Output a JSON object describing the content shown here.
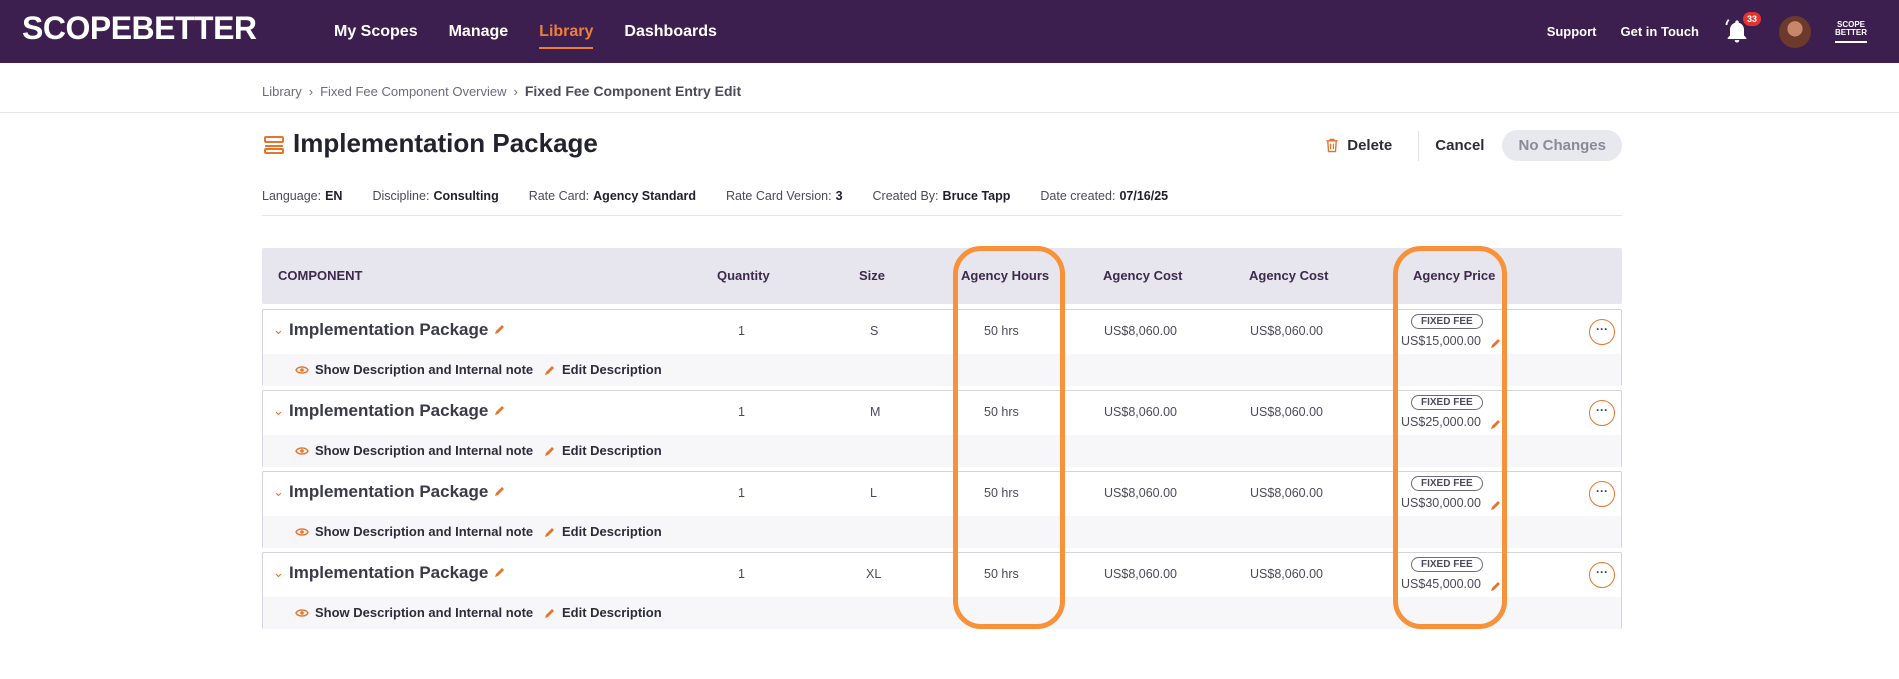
{
  "app": {
    "logo": "SCOPEBETTER",
    "brand_color": "#3d1f4f",
    "accent_color": "#f07e3a"
  },
  "nav": {
    "items": [
      {
        "label": "My Scopes",
        "active": false
      },
      {
        "label": "Manage",
        "active": false
      },
      {
        "label": "Library",
        "active": true
      },
      {
        "label": "Dashboards",
        "active": false
      }
    ]
  },
  "topright": {
    "support": "Support",
    "get_in_touch": "Get in Touch",
    "notifications": "33",
    "mini_logo": "SCOPE BETTER"
  },
  "breadcrumb": {
    "items": [
      "Library",
      "Fixed Fee Component Overview"
    ],
    "current": "Fixed Fee Component Entry Edit"
  },
  "page": {
    "title": "Implementation Package",
    "title_icon": "stack-icon"
  },
  "actions": {
    "delete": "Delete",
    "cancel": "Cancel",
    "no_changes": "No Changes"
  },
  "meta": {
    "language_label": "Language:",
    "language": "EN",
    "discipline_label": "Discipline:",
    "discipline": "Consulting",
    "rate_card_label": "Rate Card:",
    "rate_card": "Agency Standard",
    "rate_card_version_label": "Rate Card Version:",
    "rate_card_version": "3",
    "created_by_label": "Created By:",
    "created_by": "Bruce Tapp",
    "date_created_label": "Date created:",
    "date_created": "07/16/25"
  },
  "table": {
    "headers": [
      "COMPONENT",
      "Quantity",
      "Size",
      "Agency Hours",
      "Agency Cost",
      "Agency Cost",
      "Agency Price"
    ],
    "rows": [
      {
        "name": "Implementation Package",
        "quantity": "1",
        "size": "S",
        "hours": "50 hrs",
        "cost1": "US$8,060.00",
        "cost2": "US$8,060.00",
        "badge": "FIXED FEE",
        "price": "US$15,000.00",
        "more": "···"
      },
      {
        "name": "Implementation Package",
        "quantity": "1",
        "size": "M",
        "hours": "50 hrs",
        "cost1": "US$8,060.00",
        "cost2": "US$8,060.00",
        "badge": "FIXED FEE",
        "price": "US$25,000.00",
        "more": "···"
      },
      {
        "name": "Implementation Package",
        "quantity": "1",
        "size": "L",
        "hours": "50 hrs",
        "cost1": "US$8,060.00",
        "cost2": "US$8,060.00",
        "badge": "FIXED FEE",
        "price": "US$30,000.00",
        "more": "···"
      },
      {
        "name": "Implementation Package",
        "quantity": "1",
        "size": "XL",
        "hours": "50 hrs",
        "cost1": "US$8,060.00",
        "cost2": "US$8,060.00",
        "badge": "FIXED FEE",
        "price": "US$45,000.00",
        "more": "···"
      }
    ],
    "show_description": "Show Description and Internal note",
    "edit_description": "Edit Description"
  },
  "highlight_color": "#f7923a"
}
